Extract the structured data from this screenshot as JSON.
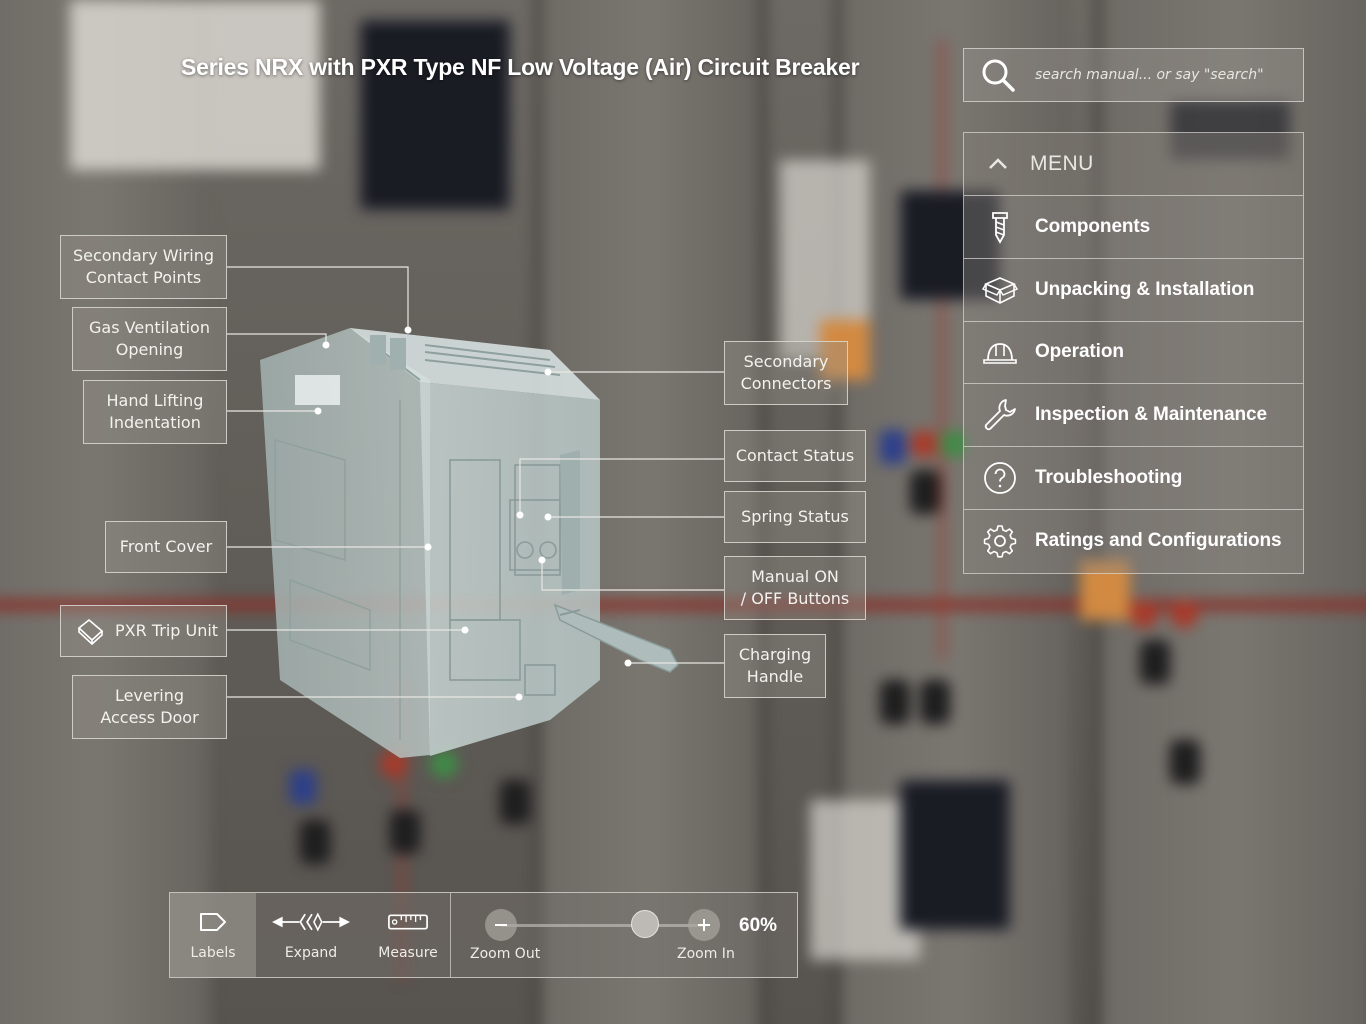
{
  "title": "Series NRX with PXR Type NF Low Voltage (Air) Circuit Breaker",
  "search": {
    "placeholder": "search manual... or say \"search\"",
    "icon": "search-icon"
  },
  "menu": {
    "header": "MENU",
    "header_icon": "chevron-up-icon",
    "items": [
      {
        "label": "Components",
        "icon": "screw-icon"
      },
      {
        "label": "Unpacking & Installation",
        "icon": "box-icon"
      },
      {
        "label": "Operation",
        "icon": "hard-hat-icon"
      },
      {
        "label": "Inspection & Maintenance",
        "icon": "wrench-icon"
      },
      {
        "label": "Troubleshooting",
        "icon": "question-circle-icon"
      },
      {
        "label": "Ratings and Configurations",
        "icon": "gear-icon"
      }
    ]
  },
  "callouts": {
    "secondary_wiring": "Secondary Wiring\nContact Points",
    "gas_ventilation": "Gas Ventilation\nOpening",
    "hand_lifting": "Hand Lifting\nIndentation",
    "front_cover": "Front Cover",
    "pxr_trip_unit": "PXR Trip Unit",
    "levering_door": "Levering\nAccess Door",
    "secondary_connectors": "Secondary\nConnectors",
    "contact_status": "Contact Status",
    "spring_status": "Spring Status",
    "manual_buttons": "Manual ON\n/ OFF Buttons",
    "charging_handle": "Charging\nHandle"
  },
  "toolbar": {
    "labels": "Labels",
    "expand": "Expand",
    "measure": "Measure",
    "zoom_out": "Zoom Out",
    "zoom_in": "Zoom In",
    "zoom_value": "60%",
    "zoom_level": 0.6
  },
  "colors": {
    "panel_bg": "rgba(140,136,130,0.40)",
    "panel_border": "#d7d4cf",
    "text": "#ffffff"
  }
}
